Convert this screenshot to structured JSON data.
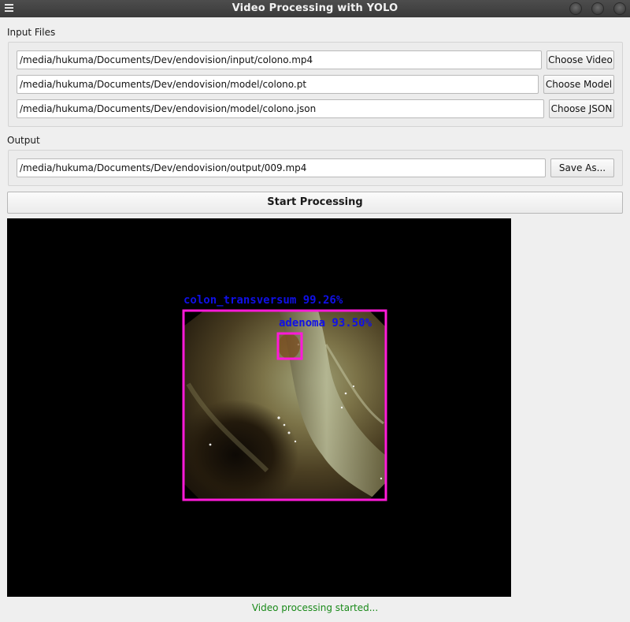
{
  "window": {
    "title": "Video Processing with YOLO",
    "menu_icon": "hamburger-menu-icon",
    "controls": [
      "minimize-icon",
      "maximize-icon",
      "close-icon"
    ]
  },
  "input_section": {
    "label": "Input Files",
    "rows": [
      {
        "value": "/media/hukuma/Documents/Dev/endovision/input/colono.mp4",
        "button": "Choose Video"
      },
      {
        "value": "/media/hukuma/Documents/Dev/endovision/model/colono.pt",
        "button": "Choose Model"
      },
      {
        "value": "/media/hukuma/Documents/Dev/endovision/model/colono.json",
        "button": "Choose JSON"
      }
    ]
  },
  "output_section": {
    "label": "Output",
    "value": "/media/hukuma/Documents/Dev/endovision/output/009.mp4",
    "button": "Save As..."
  },
  "start_button": "Start Processing",
  "preview": {
    "detections": [
      {
        "label": "colon_transversum 99.26%",
        "color": "#ff1ad9",
        "label_color": "#1010e6"
      },
      {
        "label": "adenoma 93.50%",
        "color": "#ff1ad9",
        "label_color": "#1010e6"
      }
    ]
  },
  "status": {
    "text": "Video processing started...",
    "color": "#1a8a1a"
  }
}
